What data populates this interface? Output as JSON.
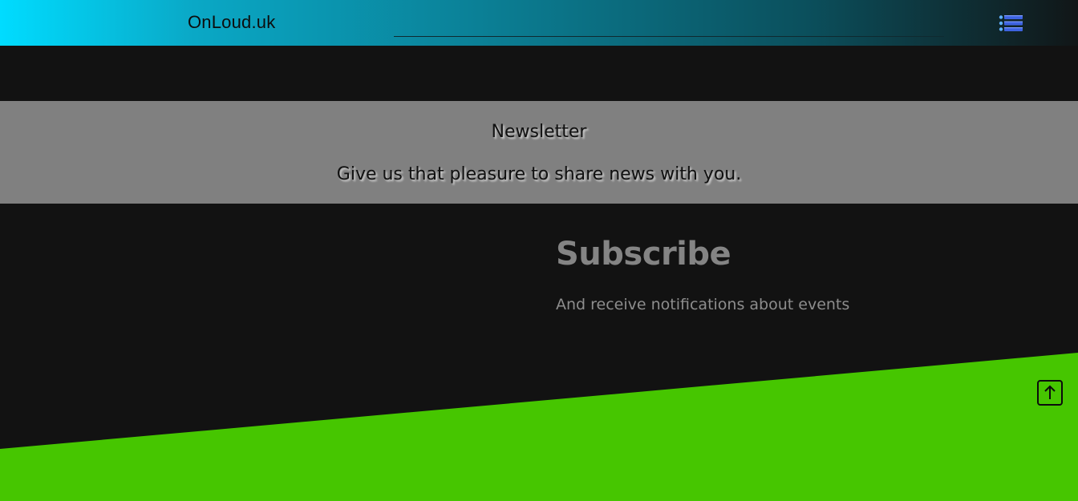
{
  "header": {
    "brand": "OnLoud.uk",
    "menu_icon": "list-menu-icon"
  },
  "newsletter": {
    "title": "Newsletter",
    "subtitle": "Give us that pleasure to share news with you."
  },
  "subscribe": {
    "title": "Subscribe",
    "text": "And receive notifications about events"
  },
  "footer": {
    "back_to_top_icon": "arrow-up-icon"
  },
  "colors": {
    "header_gradient_start": "#00dcff",
    "header_gradient_end": "#111617",
    "page_background": "#121212",
    "newsletter_band": "#808080",
    "accent_green": "#46c600",
    "menu_icon_blue": "#3d63e0"
  }
}
